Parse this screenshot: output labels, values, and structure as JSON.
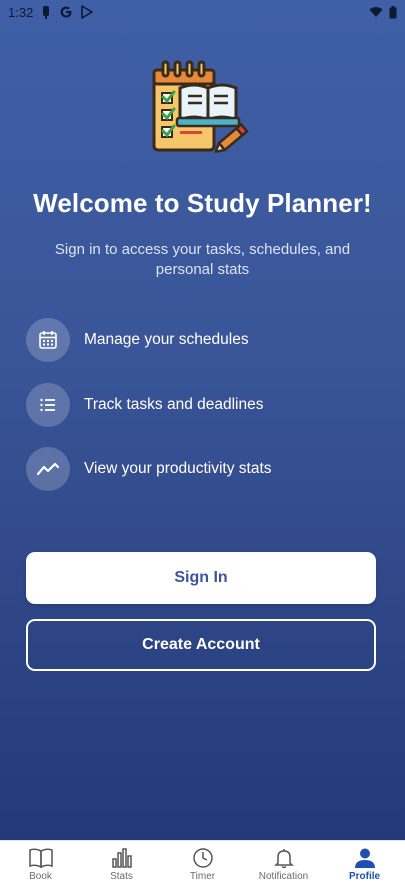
{
  "status_bar": {
    "time": "1:32"
  },
  "welcome": {
    "title": "Welcome to Study Planner!",
    "subtitle": "Sign in to access your tasks, schedules, and personal stats"
  },
  "features": [
    {
      "icon": "calendar-icon",
      "label": "Manage your schedules"
    },
    {
      "icon": "list-icon",
      "label": "Track tasks and deadlines"
    },
    {
      "icon": "trend-line-icon",
      "label": "View your productivity stats"
    }
  ],
  "actions": {
    "sign_in": "Sign In",
    "create_account": "Create Account"
  },
  "bottom_nav": {
    "items": [
      {
        "icon": "book-icon",
        "label": "Book"
      },
      {
        "icon": "bar-chart-icon",
        "label": "Stats"
      },
      {
        "icon": "clock-icon",
        "label": "Timer"
      },
      {
        "icon": "bell-icon",
        "label": "Notification"
      },
      {
        "icon": "person-icon",
        "label": "Profile"
      }
    ],
    "active": "Profile"
  },
  "colors": {
    "primary": "#3a5699",
    "active_nav": "#1f4fb3"
  }
}
